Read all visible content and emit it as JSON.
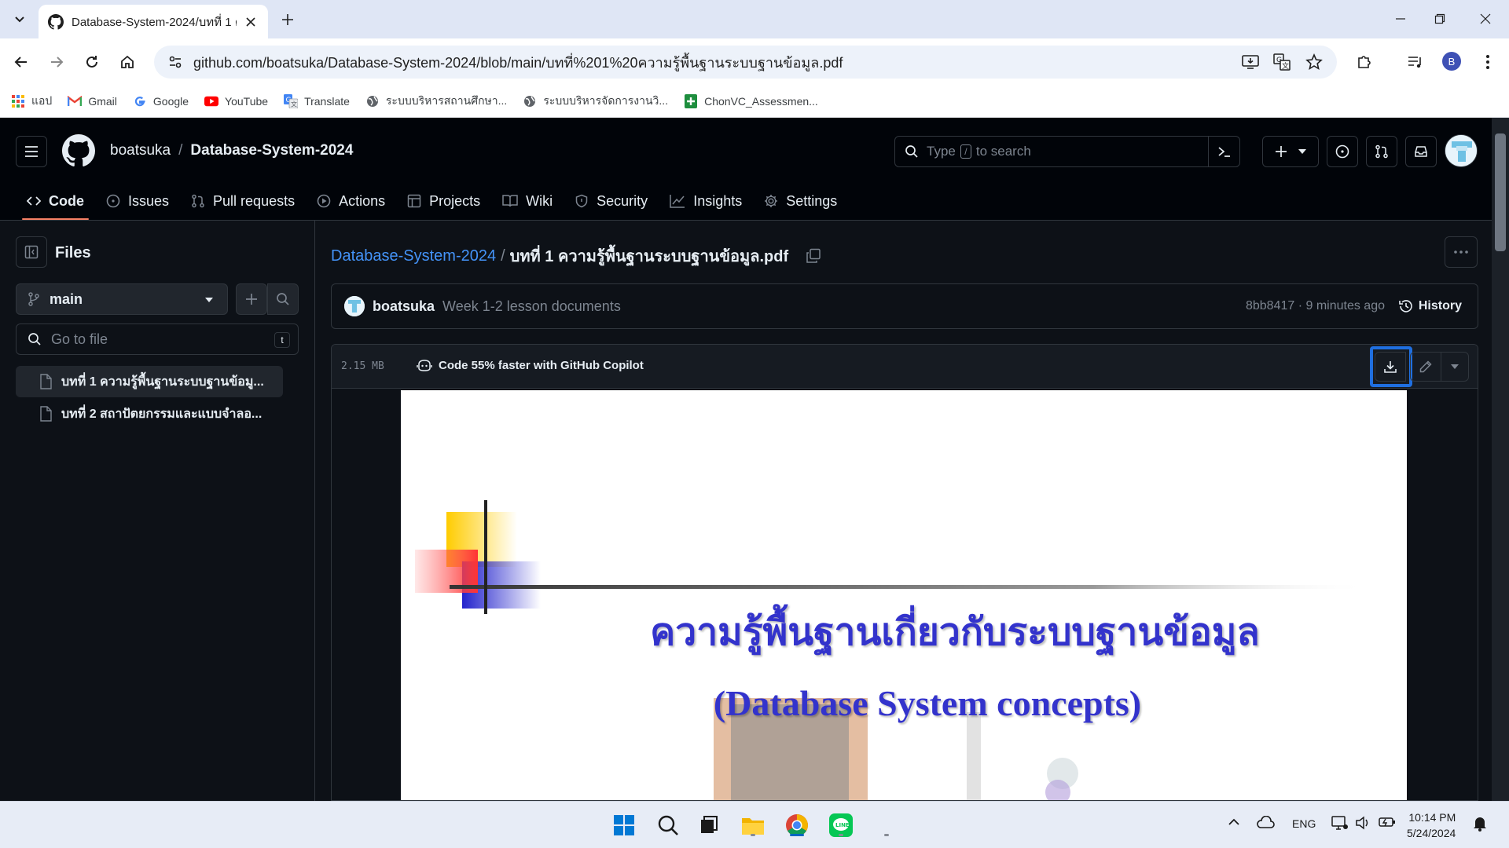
{
  "browser": {
    "tab_title": "Database-System-2024/บทที่ 1 ค",
    "url": "github.com/boatsuka/Database-System-2024/blob/main/บทที่%201%20ความรู้พื้นฐานระบบฐานข้อมูล.pdf",
    "profile_initial": "B",
    "bookmarks": [
      {
        "label": "แอป",
        "icon": "apps-grid-icon"
      },
      {
        "label": "Gmail",
        "icon": "gmail-icon"
      },
      {
        "label": "Google",
        "icon": "google-icon"
      },
      {
        "label": "YouTube",
        "icon": "youtube-icon"
      },
      {
        "label": "Translate",
        "icon": "translate-icon"
      },
      {
        "label": "ระบบบริหารสถานศึกษา...",
        "icon": "globe-icon"
      },
      {
        "label": "ระบบบริหารจัดการงานวิ...",
        "icon": "globe-icon"
      },
      {
        "label": "ChonVC_Assessmen...",
        "icon": "sheets-icon"
      }
    ]
  },
  "github": {
    "owner": "boatsuka",
    "repo": "Database-System-2024",
    "search_prefix": "Type",
    "search_key": "/",
    "search_suffix": "to search",
    "nav": [
      {
        "label": "Code",
        "icon": "code-icon",
        "active": true
      },
      {
        "label": "Issues",
        "icon": "issues-icon"
      },
      {
        "label": "Pull requests",
        "icon": "pull-request-icon"
      },
      {
        "label": "Actions",
        "icon": "play-icon"
      },
      {
        "label": "Projects",
        "icon": "table-icon"
      },
      {
        "label": "Wiki",
        "icon": "book-icon"
      },
      {
        "label": "Security",
        "icon": "shield-icon"
      },
      {
        "label": "Insights",
        "icon": "graph-icon"
      },
      {
        "label": "Settings",
        "icon": "gear-icon"
      }
    ]
  },
  "sidebar": {
    "title": "Files",
    "branch": "main",
    "goto_placeholder": "Go to file",
    "goto_key": "t",
    "files": [
      {
        "name": "บทที่ 1 ความรู้พื้นฐานระบบฐานข้อมู...",
        "active": true
      },
      {
        "name": "บทที่ 2 สถาปัตยกรรมและแบบจำลอ...",
        "active": false
      }
    ]
  },
  "file": {
    "crumb_repo": "Database-System-2024",
    "crumb_sep": "/",
    "crumb_file": "บทที่ 1 ความรู้พื้นฐานระบบฐานข้อมูล.pdf",
    "commit_author": "boatsuka",
    "commit_message": "Week 1-2 lesson documents",
    "commit_meta": "8bb8417 · 9 minutes ago",
    "history_label": "History",
    "size": "2.15 MB",
    "copilot_text": "Code 55% faster with GitHub Copilot"
  },
  "pdf": {
    "title_th": "ความรู้พื้นฐานเกี่ยวกับระบบฐานข้อมูล",
    "title_en": "(Database System concepts)"
  },
  "taskbar": {
    "lang": "ENG",
    "time": "10:14 PM",
    "date": "5/24/2024"
  },
  "colors": {
    "accent_link": "#4493f8",
    "active_tab_underline": "#f78166",
    "highlight_box": "#1f6fe0",
    "slide_title": "#3333cc"
  }
}
